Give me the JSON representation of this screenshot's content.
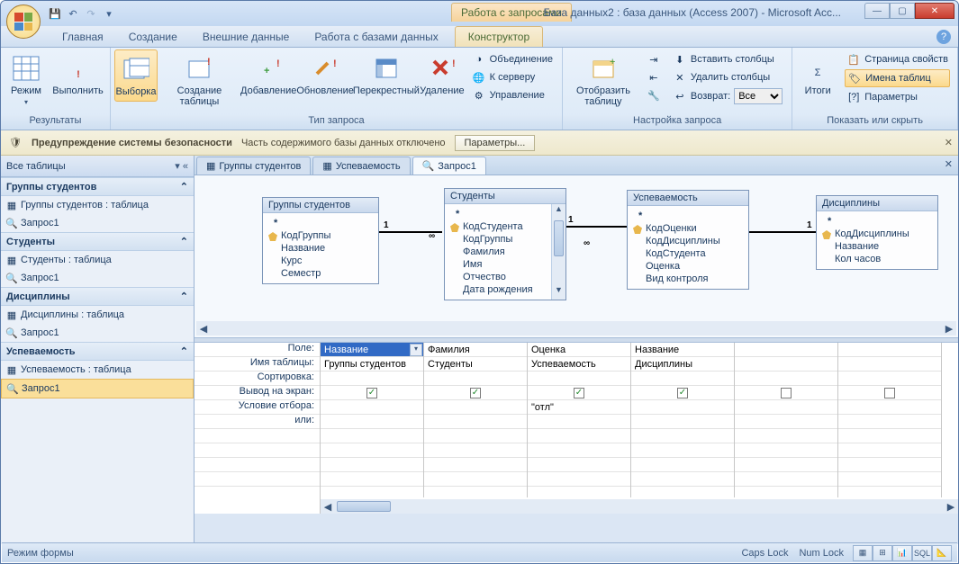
{
  "window": {
    "context_tab_group": "Работа с запросами",
    "title": "База данных2 : база данных (Access 2007) - Microsoft Acc..."
  },
  "qat": {
    "save": "💾",
    "undo": "↶",
    "redo": "↷",
    "custom": "▾"
  },
  "tabs": {
    "home": "Главная",
    "create": "Создание",
    "external": "Внешние данные",
    "dbtools": "Работа с базами данных",
    "design": "Конструктор"
  },
  "ribbon": {
    "results": {
      "label": "Результаты",
      "view": "Режим",
      "run": "Выполнить"
    },
    "querytype": {
      "label": "Тип запроса",
      "select": "Выборка",
      "maketable": "Создание таблицы",
      "append": "Добавление",
      "update": "Обновление",
      "crosstab": "Перекрестный",
      "delete": "Удаление",
      "union": "Объединение",
      "passthrough": "К серверу",
      "datadef": "Управление"
    },
    "setup": {
      "label": "Настройка запроса",
      "showtable": "Отобразить таблицу",
      "insertrows": "",
      "insertcols": "Вставить столбцы",
      "deletecols": "Удалить столбцы",
      "return": "Возврат:",
      "return_val": "Все"
    },
    "showhide": {
      "label": "Показать или скрыть",
      "totals": "Итоги",
      "propsheet": "Страница свойств",
      "tablenames": "Имена таблиц",
      "params": "Параметры"
    }
  },
  "security": {
    "title": "Предупреждение системы безопасности",
    "msg": "Часть содержимого базы данных отключено",
    "options": "Параметры..."
  },
  "nav": {
    "header": "Все таблицы",
    "groups": [
      {
        "title": "Группы студентов",
        "items": [
          "Группы студентов : таблица",
          "Запрос1"
        ]
      },
      {
        "title": "Студенты",
        "items": [
          "Студенты : таблица",
          "Запрос1"
        ]
      },
      {
        "title": "Дисциплины",
        "items": [
          "Дисциплины : таблица",
          "Запрос1"
        ]
      },
      {
        "title": "Успеваемость",
        "items": [
          "Успеваемость : таблица",
          "Запрос1"
        ]
      }
    ]
  },
  "doctabs": {
    "t1": "Группы студентов",
    "t2": "Успеваемость",
    "t3": "Запрос1"
  },
  "designer_tables": {
    "t1": {
      "title": "Группы студентов",
      "fields": [
        "*",
        "КодГруппы",
        "Название",
        "Курс",
        "Семестр"
      ],
      "keys": [
        1
      ]
    },
    "t2": {
      "title": "Студенты",
      "fields": [
        "*",
        "КодСтудента",
        "КодГруппы",
        "Фамилия",
        "Имя",
        "Отчество",
        "Дата рождения"
      ],
      "keys": [
        1
      ]
    },
    "t3": {
      "title": "Успеваемость",
      "fields": [
        "*",
        "КодОценки",
        "КодДисциплины",
        "КодСтудента",
        "Оценка",
        "Вид контроля"
      ],
      "keys": [
        1
      ]
    },
    "t4": {
      "title": "Дисциплины",
      "fields": [
        "*",
        "КодДисциплины",
        "Название",
        "Кол часов"
      ],
      "keys": [
        1
      ]
    }
  },
  "rel": {
    "one": "1",
    "inf": "∞"
  },
  "gridrows": {
    "field": "Поле:",
    "table": "Имя таблицы:",
    "sort": "Сортировка:",
    "show": "Вывод на экран:",
    "criteria": "Условие отбора:",
    "or": "или:"
  },
  "gridcols": [
    {
      "field": "Название",
      "table": "Группы студентов",
      "show": true,
      "criteria": "",
      "selected": true
    },
    {
      "field": "Фамилия",
      "table": "Студенты",
      "show": true,
      "criteria": ""
    },
    {
      "field": "Оценка",
      "table": "Успеваемость",
      "show": true,
      "criteria": "\"отл\""
    },
    {
      "field": "Название",
      "table": "Дисциплины",
      "show": true,
      "criteria": ""
    },
    {
      "field": "",
      "table": "",
      "show": false,
      "criteria": ""
    },
    {
      "field": "",
      "table": "",
      "show": false,
      "criteria": ""
    }
  ],
  "status": {
    "mode": "Режим формы",
    "caps": "Caps Lock",
    "num": "Num Lock"
  }
}
